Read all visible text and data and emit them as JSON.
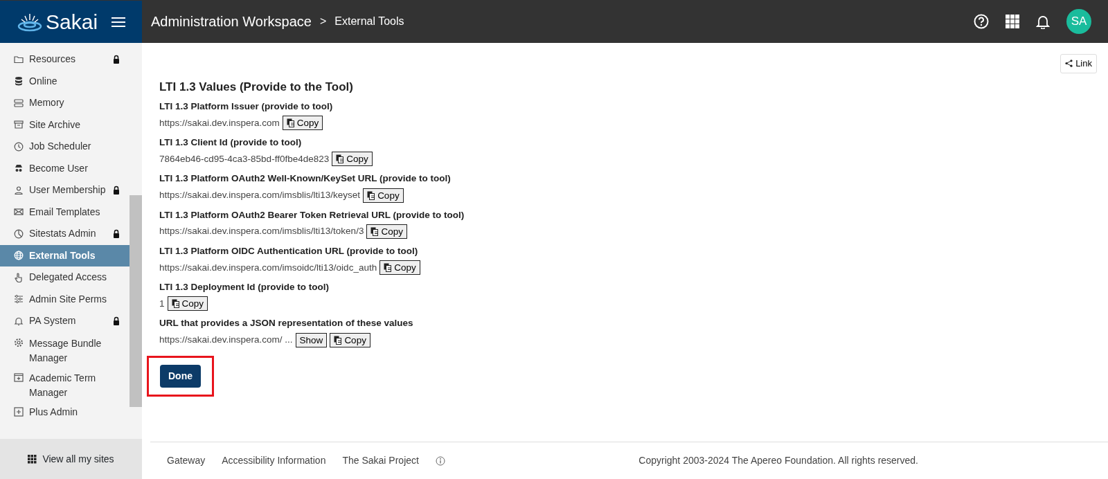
{
  "header": {
    "brand": "Sakai",
    "site_title": "Administration Workspace",
    "separator": ">",
    "page_title": "External Tools",
    "avatar": "SA"
  },
  "sidebar": {
    "items": [
      {
        "label": "Resources",
        "locked": true,
        "selected": false
      },
      {
        "label": "Online",
        "locked": false,
        "selected": false
      },
      {
        "label": "Memory",
        "locked": false,
        "selected": false
      },
      {
        "label": "Site Archive",
        "locked": false,
        "selected": false
      },
      {
        "label": "Job Scheduler",
        "locked": false,
        "selected": false
      },
      {
        "label": "Become User",
        "locked": false,
        "selected": false
      },
      {
        "label": "User Membership",
        "locked": true,
        "selected": false
      },
      {
        "label": "Email Templates",
        "locked": false,
        "selected": false
      },
      {
        "label": "Sitestats Admin",
        "locked": true,
        "selected": false
      },
      {
        "label": "External Tools",
        "locked": false,
        "selected": true
      },
      {
        "label": "Delegated Access",
        "locked": false,
        "selected": false
      },
      {
        "label": "Admin Site Perms",
        "locked": false,
        "selected": false
      },
      {
        "label": "PA System",
        "locked": true,
        "selected": false
      },
      {
        "label": "Message Bundle Manager",
        "locked": false,
        "selected": false
      },
      {
        "label": "Academic Term Manager",
        "locked": false,
        "selected": false
      },
      {
        "label": "Plus Admin",
        "locked": false,
        "selected": false
      }
    ],
    "view_all": "View all my sites"
  },
  "link_button": "Link",
  "heading": "LTI 1.3 Values (Provide to the Tool)",
  "fields": [
    {
      "label": "LTI 1.3 Platform Issuer (provide to tool)",
      "value": "https://sakai.dev.inspera.com",
      "buttons": [
        {
          "kind": "copy",
          "label": "Copy"
        }
      ]
    },
    {
      "label": "LTI 1.3 Client Id (provide to tool)",
      "value": "7864eb46-cd95-4ca3-85bd-ff0fbe4de823",
      "buttons": [
        {
          "kind": "copy",
          "label": "Copy"
        }
      ]
    },
    {
      "label": "LTI 1.3 Platform OAuth2 Well-Known/KeySet URL (provide to tool)",
      "value": "https://sakai.dev.inspera.com/imsblis/lti13/keyset",
      "buttons": [
        {
          "kind": "copy",
          "label": "Copy"
        }
      ]
    },
    {
      "label": "LTI 1.3 Platform OAuth2 Bearer Token Retrieval URL (provide to tool)",
      "value": "https://sakai.dev.inspera.com/imsblis/lti13/token/3",
      "buttons": [
        {
          "kind": "copy",
          "label": "Copy"
        }
      ]
    },
    {
      "label": "LTI 1.3 Platform OIDC Authentication URL (provide to tool)",
      "value": "https://sakai.dev.inspera.com/imsoidc/lti13/oidc_auth",
      "buttons": [
        {
          "kind": "copy",
          "label": "Copy"
        }
      ]
    },
    {
      "label": "LTI 1.3 Deployment Id (provide to tool)",
      "value": "1",
      "buttons": [
        {
          "kind": "copy",
          "label": "Copy"
        }
      ]
    },
    {
      "label": "URL that provides a JSON representation of these values",
      "value": "https://sakai.dev.inspera.com/ ...",
      "buttons": [
        {
          "kind": "plain",
          "label": "Show"
        },
        {
          "kind": "copy",
          "label": "Copy"
        }
      ]
    }
  ],
  "done_button": {
    "label": "Done",
    "highlighted": true
  },
  "footer": {
    "links": [
      "Gateway",
      "Accessibility Information",
      "The Sakai Project"
    ],
    "copyright": "Copyright 2003-2024 The Apereo Foundation. All rights reserved."
  }
}
